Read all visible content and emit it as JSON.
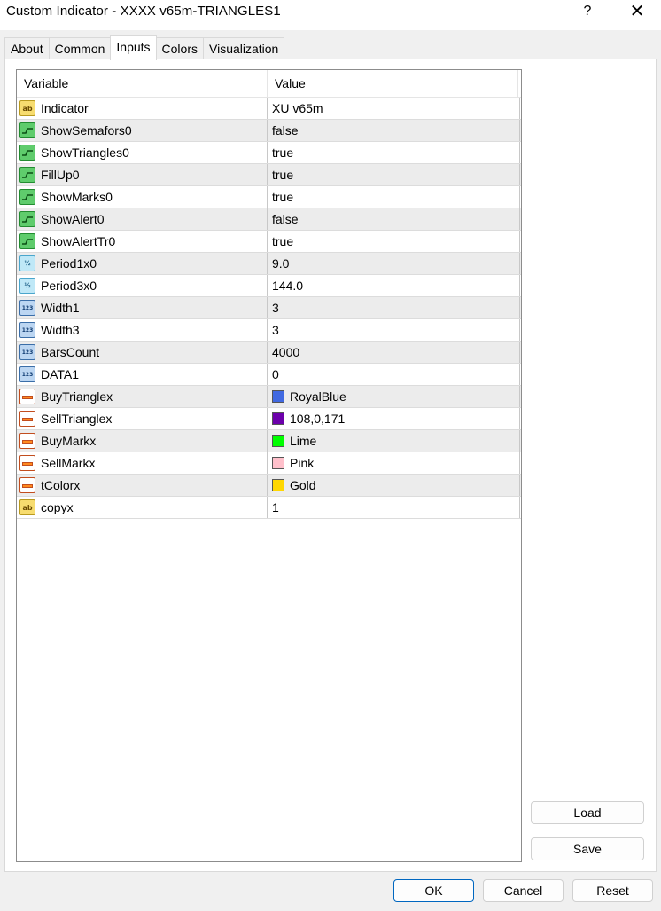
{
  "window": {
    "title": "Custom Indicator - XXXX v65m-TRIANGLES1",
    "help_label": "?",
    "close_label": "✕"
  },
  "tabs": [
    {
      "label": "About"
    },
    {
      "label": "Common"
    },
    {
      "label": "Inputs"
    },
    {
      "label": "Colors"
    },
    {
      "label": "Visualization"
    }
  ],
  "grid": {
    "headers": {
      "variable": "Variable",
      "value": "Value"
    },
    "rows": [
      {
        "icon": "ab",
        "variable": "Indicator",
        "value": "XU v65m"
      },
      {
        "icon": "bool",
        "variable": "ShowSemafors0",
        "value": "false"
      },
      {
        "icon": "bool",
        "variable": "ShowTriangles0",
        "value": "true"
      },
      {
        "icon": "bool",
        "variable": "FillUp0",
        "value": "true"
      },
      {
        "icon": "bool",
        "variable": "ShowMarks0",
        "value": "true"
      },
      {
        "icon": "bool",
        "variable": "ShowAlert0",
        "value": "false"
      },
      {
        "icon": "bool",
        "variable": "ShowAlertTr0",
        "value": "true"
      },
      {
        "icon": "dbl",
        "variable": "Period1x0",
        "value": "9.0"
      },
      {
        "icon": "dbl",
        "variable": "Period3x0",
        "value": "144.0"
      },
      {
        "icon": "int",
        "variable": "Width1",
        "value": "3"
      },
      {
        "icon": "int",
        "variable": "Width3",
        "value": "3"
      },
      {
        "icon": "int",
        "variable": "BarsCount",
        "value": "4000"
      },
      {
        "icon": "int",
        "variable": "DATA1",
        "value": "0"
      },
      {
        "icon": "color",
        "variable": "BuyTrianglex",
        "value": "RoyalBlue",
        "swatch": "#4169e1"
      },
      {
        "icon": "color",
        "variable": "SellTrianglex",
        "value": "108,0,171",
        "swatch": "#6c00ab"
      },
      {
        "icon": "color",
        "variable": "BuyMarkx",
        "value": "Lime",
        "swatch": "#00ff00"
      },
      {
        "icon": "color",
        "variable": "SellMarkx",
        "value": "Pink",
        "swatch": "#ffc0cb"
      },
      {
        "icon": "color",
        "variable": "tColorx",
        "value": "Gold",
        "swatch": "#ffd700"
      },
      {
        "icon": "ab",
        "variable": "copyx",
        "value": "1"
      }
    ]
  },
  "icon_glyphs": {
    "ab": "ab",
    "dbl": "½",
    "int": "123"
  },
  "side_buttons": {
    "load": "Load",
    "save": "Save"
  },
  "footer_buttons": {
    "ok": "OK",
    "cancel": "Cancel",
    "reset": "Reset"
  }
}
